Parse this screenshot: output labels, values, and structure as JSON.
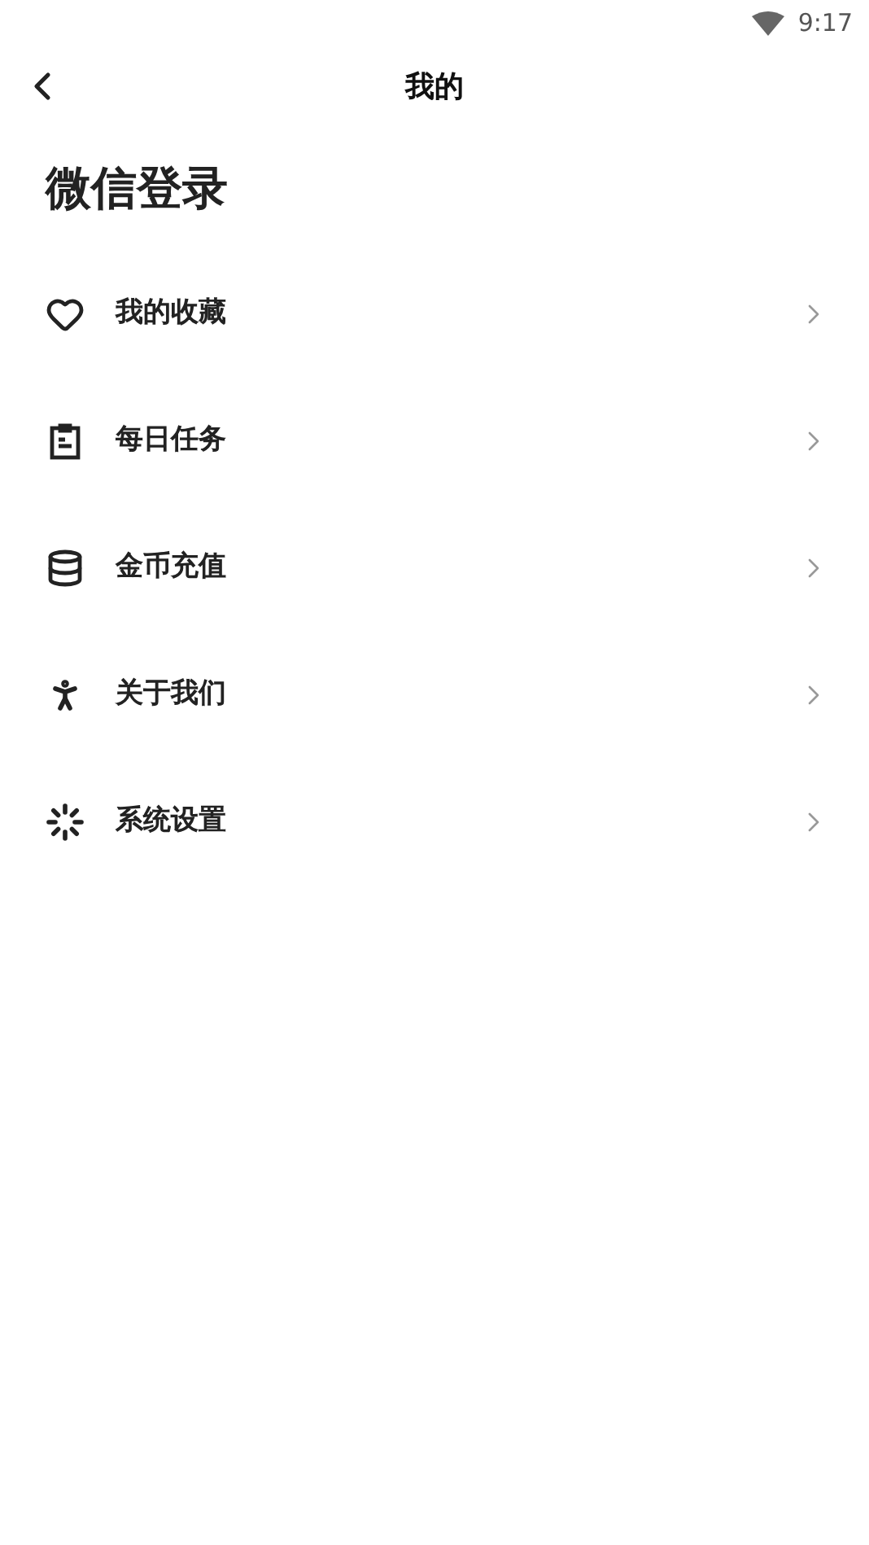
{
  "status_bar": {
    "time": "9:17"
  },
  "header": {
    "title": "我的"
  },
  "login": {
    "label": "微信登录"
  },
  "menu": [
    {
      "kind": "heart",
      "label": "我的收藏"
    },
    {
      "kind": "clipboard",
      "label": "每日任务"
    },
    {
      "kind": "coins",
      "label": "金币充值"
    },
    {
      "kind": "person",
      "label": "关于我们"
    },
    {
      "kind": "settings",
      "label": "系统设置"
    }
  ]
}
